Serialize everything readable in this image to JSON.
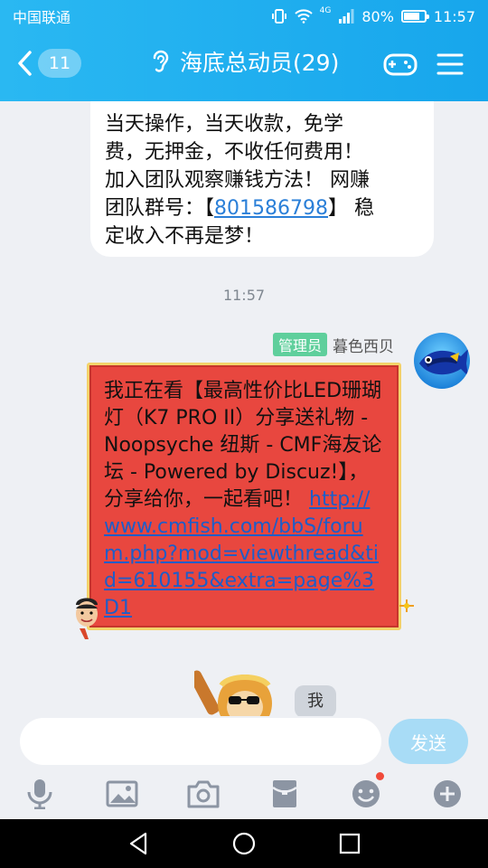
{
  "status_bar": {
    "carrier": "中国联通",
    "network": "4G",
    "battery": "80%",
    "battery_level": 0.8,
    "time": "11:57"
  },
  "header": {
    "back_count": "11",
    "title": "海底总动员(29)"
  },
  "messages": {
    "previous": {
      "line1": "当天操作，当天收款，免学",
      "line2": "费，无押金，不收任何费用！",
      "line3": "加入团队观察赚钱方法！ 网赚",
      "line4_prefix": "团队群号：【",
      "line4_link": "801586798",
      "line4_suffix": "】 稳",
      "line5": "定收入不再是梦！"
    },
    "timestamp": "11:57",
    "current": {
      "badge": "管理员",
      "sender": "暮色西贝",
      "text": "我正在看【最高性价比LED珊瑚灯（K7 PRO II）分享送礼物 - Noopsyche 纽斯 - CMF海友论坛 - Powered by Discuz!】，分享给你，一起看吧！ ",
      "link": "http://www.cmfish.com/bbS/forum.php?mod=viewthread&tid=610155&extra=page%3D1"
    },
    "me_label": "我"
  },
  "input": {
    "placeholder": "",
    "value": "",
    "send_label": "发送"
  },
  "toolbar": {
    "icons": [
      "microphone-icon",
      "image-icon",
      "camera-icon",
      "red-packet-icon",
      "emoji-icon",
      "plus-icon"
    ]
  },
  "colors": {
    "header": "#17a6ec",
    "admin_badge": "#5fcf9c",
    "red_bubble": "#e8473f",
    "link": "#2a7fd8"
  }
}
